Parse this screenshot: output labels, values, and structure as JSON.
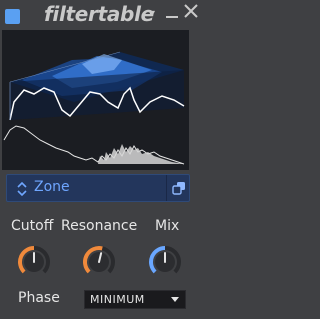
{
  "app": {
    "title": "filtertable"
  },
  "zone": {
    "label": "Zone"
  },
  "params": {
    "cutoff_label": "Cutoff",
    "resonance_label": "Resonance",
    "mix_label": "Mix",
    "cutoff_value": 0.5,
    "resonance_value": 0.55,
    "mix_value": 0.5
  },
  "phase": {
    "label": "Phase",
    "value": "MINIMUM"
  },
  "colors": {
    "accent": "#5aa0f2",
    "knob_cutoff": "#f08a3c",
    "knob_resonance": "#f08a3c",
    "knob_mix": "#6aa7ff",
    "background": "#3f4043"
  }
}
